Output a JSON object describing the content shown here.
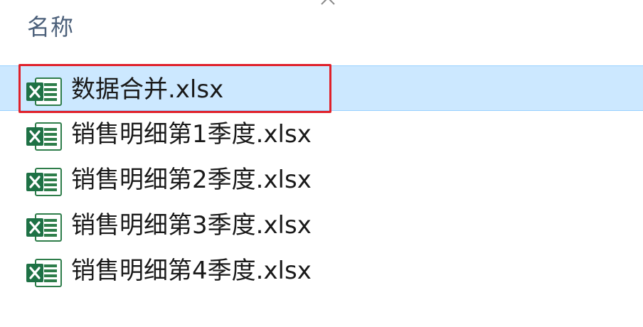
{
  "header": {
    "column_name_label": "名称",
    "sort_icon": "chevron-up-icon"
  },
  "files": [
    {
      "name": "数据合并.xlsx",
      "icon": "excel-file-icon",
      "selected": true
    },
    {
      "name": "销售明细第1季度.xlsx",
      "icon": "excel-file-icon",
      "selected": false
    },
    {
      "name": "销售明细第2季度.xlsx",
      "icon": "excel-file-icon",
      "selected": false
    },
    {
      "name": "销售明细第3季度.xlsx",
      "icon": "excel-file-icon",
      "selected": false
    },
    {
      "name": "销售明细第4季度.xlsx",
      "icon": "excel-file-icon",
      "selected": false
    }
  ],
  "colors": {
    "selection_background": "#cce8ff",
    "selection_border": "#99d1ff",
    "highlight_annotation": "#e0202a",
    "excel_green": "#1e7145"
  }
}
